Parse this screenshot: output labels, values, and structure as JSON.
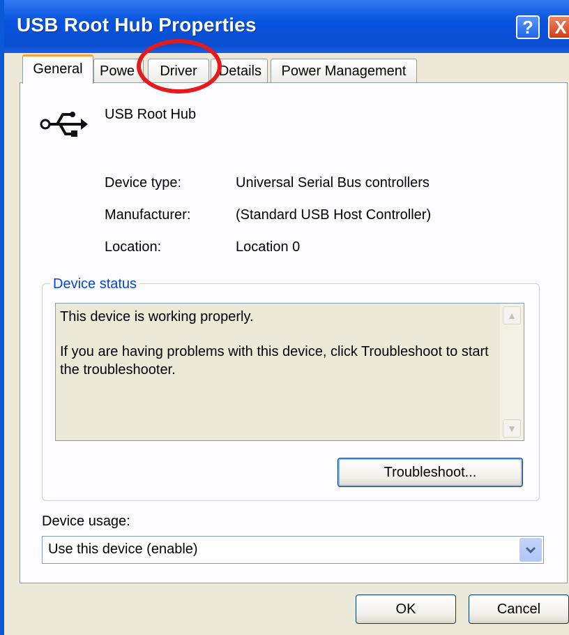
{
  "window": {
    "title": "USB Root Hub Properties"
  },
  "title_buttons": {
    "help": "?",
    "close": "X"
  },
  "tabs": [
    {
      "label": "General",
      "active": true
    },
    {
      "label": "Powe",
      "active": false
    },
    {
      "label": "Driver",
      "active": false
    },
    {
      "label": "Details",
      "active": false
    },
    {
      "label": "Power Management",
      "active": false
    }
  ],
  "device": {
    "icon": "usb-icon",
    "name": "USB Root Hub"
  },
  "properties": [
    {
      "label": "Device type:",
      "value": "Universal Serial Bus controllers"
    },
    {
      "label": "Manufacturer:",
      "value": "(Standard USB Host Controller)"
    },
    {
      "label": "Location:",
      "value": "Location 0"
    }
  ],
  "device_status": {
    "legend": "Device status",
    "line1": "This device is working properly.",
    "line2": "If you are having problems with this device, click Troubleshoot to start the troubleshooter.",
    "troubleshoot_label": "Troubleshoot..."
  },
  "device_usage": {
    "label": "Device usage:",
    "selected": "Use this device (enable)"
  },
  "footer": {
    "ok_label": "OK",
    "cancel_label": "Cancel"
  },
  "colors": {
    "titlebar": "#0754df",
    "accent_tab": "#f8a43a",
    "annotation_circle": "#e61a1a",
    "group_legend": "#0046d5"
  }
}
